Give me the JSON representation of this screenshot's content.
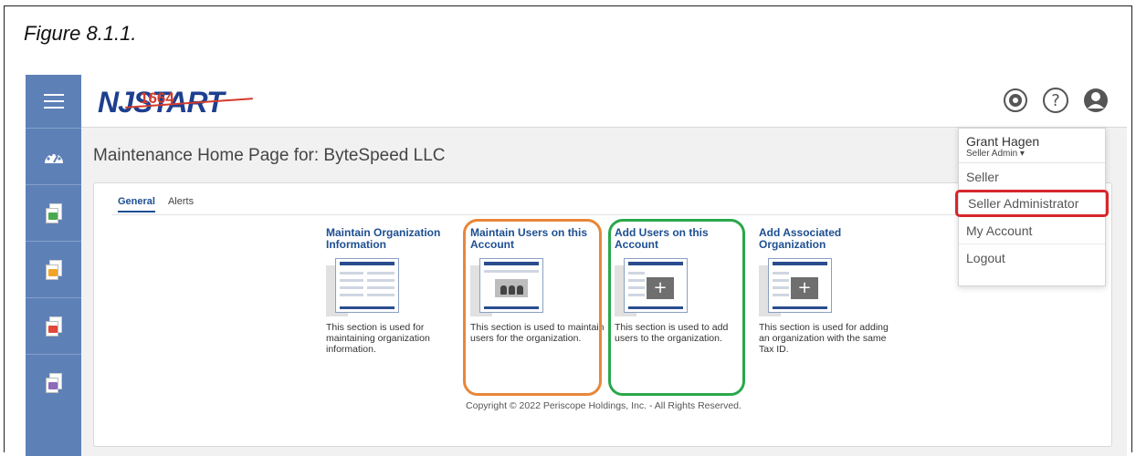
{
  "caption": "Figure 8.1.1.",
  "brand": {
    "logo_text": "NJSTART",
    "logo_year": "1664"
  },
  "header": {
    "icons": [
      "gear-icon",
      "help-icon",
      "user-icon"
    ]
  },
  "sidebar": {
    "items": [
      "menu-icon",
      "dashboard-icon",
      "document-green-icon",
      "document-orange-icon",
      "document-red-icon",
      "document-purple-icon"
    ]
  },
  "page": {
    "title": "Maintenance Home Page for: ByteSpeed LLC"
  },
  "tabs": [
    {
      "label": "General",
      "active": true
    },
    {
      "label": "Alerts",
      "active": false
    }
  ],
  "tiles": [
    {
      "title": "Maintain Organization Information",
      "description": "This section is used for maintaining organization information.",
      "icon": "organization-form-icon"
    },
    {
      "title": "Maintain Users on this Account",
      "description": "This section is used to maintain users for the organization.",
      "icon": "users-form-icon"
    },
    {
      "title": "Add Users on this Account",
      "description": "This section is used to add users to the organization.",
      "icon": "add-form-icon"
    },
    {
      "title": "Add Associated Organization",
      "description": "This section is used for adding an organization with the same Tax ID.",
      "icon": "add-form-icon"
    }
  ],
  "copyright": "Copyright © 2022 Periscope Holdings, Inc. - All Rights Reserved.",
  "user_menu": {
    "name": "Grant Hagen",
    "role": "Seller Admin ▾",
    "items": [
      {
        "label": "Seller",
        "active": false
      },
      {
        "label": "Seller Administrator",
        "active": true
      },
      {
        "label": "My Account",
        "active": false
      },
      {
        "label": "Logout",
        "active": false
      }
    ]
  },
  "colors": {
    "sidebar": "#5d80b7",
    "link": "#1d4f91",
    "highlight_orange": "#e8873a",
    "highlight_green": "#2aa84a",
    "highlight_red": "#d8262b"
  }
}
